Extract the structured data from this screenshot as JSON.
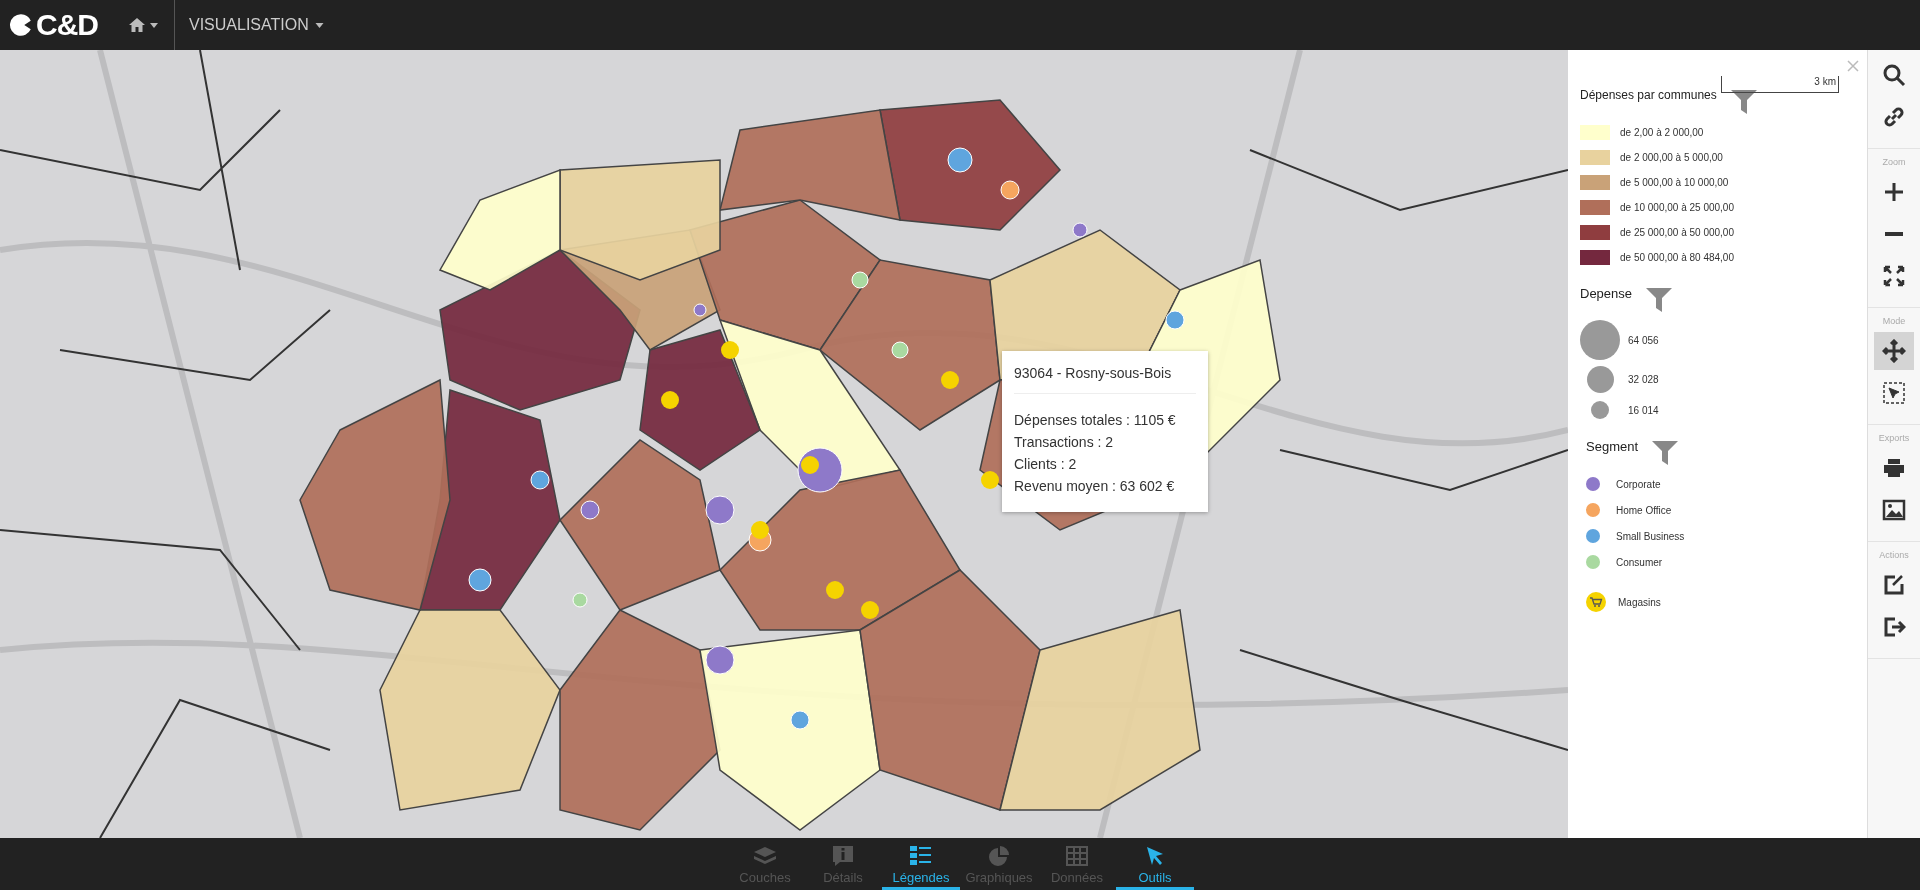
{
  "header": {
    "logo": "C&D",
    "menu": "VISUALISATION"
  },
  "tooltip": {
    "title": "93064 - Rosny-sous-Bois",
    "lines": [
      "Dépenses totales : 1105 €",
      "Transactions : 2",
      "Clients : 2",
      "Revenu moyen : 63 602 €"
    ]
  },
  "scale": "3 km",
  "legend": {
    "choropleth": {
      "title": "Dépenses par communes",
      "classes": [
        {
          "label": "de 2,00 à 2 000,00",
          "color": "#ffffcc"
        },
        {
          "label": "de 2 000,00 à 5 000,00",
          "color": "#e8d29e"
        },
        {
          "label": "de 5 000,00 à 10 000,00",
          "color": "#c9a278"
        },
        {
          "label": "de 10 000,00 à 25 000,00",
          "color": "#b06f5a"
        },
        {
          "label": "de 25 000,00 à 50 000,00",
          "color": "#8f3d3f"
        },
        {
          "label": "de 50 000,00 à 80 484,00",
          "color": "#74283e"
        }
      ]
    },
    "sizes": {
      "title": "Depense",
      "items": [
        {
          "label": "64 056"
        },
        {
          "label": "32 028"
        },
        {
          "label": "16 014"
        }
      ]
    },
    "segments": {
      "title": "Segment",
      "items": [
        {
          "label": "Corporate",
          "color": "#8e79c9"
        },
        {
          "label": "Home Office",
          "color": "#f5a55f"
        },
        {
          "label": "Small Business",
          "color": "#5fa5de"
        },
        {
          "label": "Consumer",
          "color": "#a9d9a0"
        }
      ]
    },
    "stores": {
      "label": "Magasins"
    }
  },
  "toolbar": [
    {
      "items": [
        {
          "kind": "search",
          "selected": false
        },
        {
          "kind": "link",
          "selected": false
        }
      ]
    },
    {
      "label": "Zoom",
      "items": [
        {
          "kind": "zoom-in",
          "selected": false
        },
        {
          "kind": "zoom-out",
          "selected": false
        },
        {
          "kind": "fit",
          "selected": false
        }
      ]
    },
    {
      "label": "Mode",
      "items": [
        {
          "kind": "pan",
          "selected": true
        },
        {
          "kind": "select",
          "selected": false
        }
      ]
    },
    {
      "label": "Exports",
      "items": [
        {
          "kind": "print",
          "selected": false
        },
        {
          "kind": "image",
          "selected": false
        }
      ]
    },
    {
      "label": "Actions",
      "items": [
        {
          "kind": "edit",
          "selected": false
        },
        {
          "kind": "exit",
          "selected": false
        }
      ]
    }
  ],
  "bottom_tabs": [
    {
      "label": "Couches",
      "kind": "layers",
      "selected": false
    },
    {
      "label": "Détails",
      "kind": "info",
      "selected": false
    },
    {
      "label": "Légendes",
      "kind": "legend",
      "selected": true
    },
    {
      "label": "Graphiques",
      "kind": "pie",
      "selected": false
    },
    {
      "label": "Données",
      "kind": "grid",
      "selected": false
    },
    {
      "label": "Outils",
      "kind": "cursor",
      "selected": true
    }
  ]
}
